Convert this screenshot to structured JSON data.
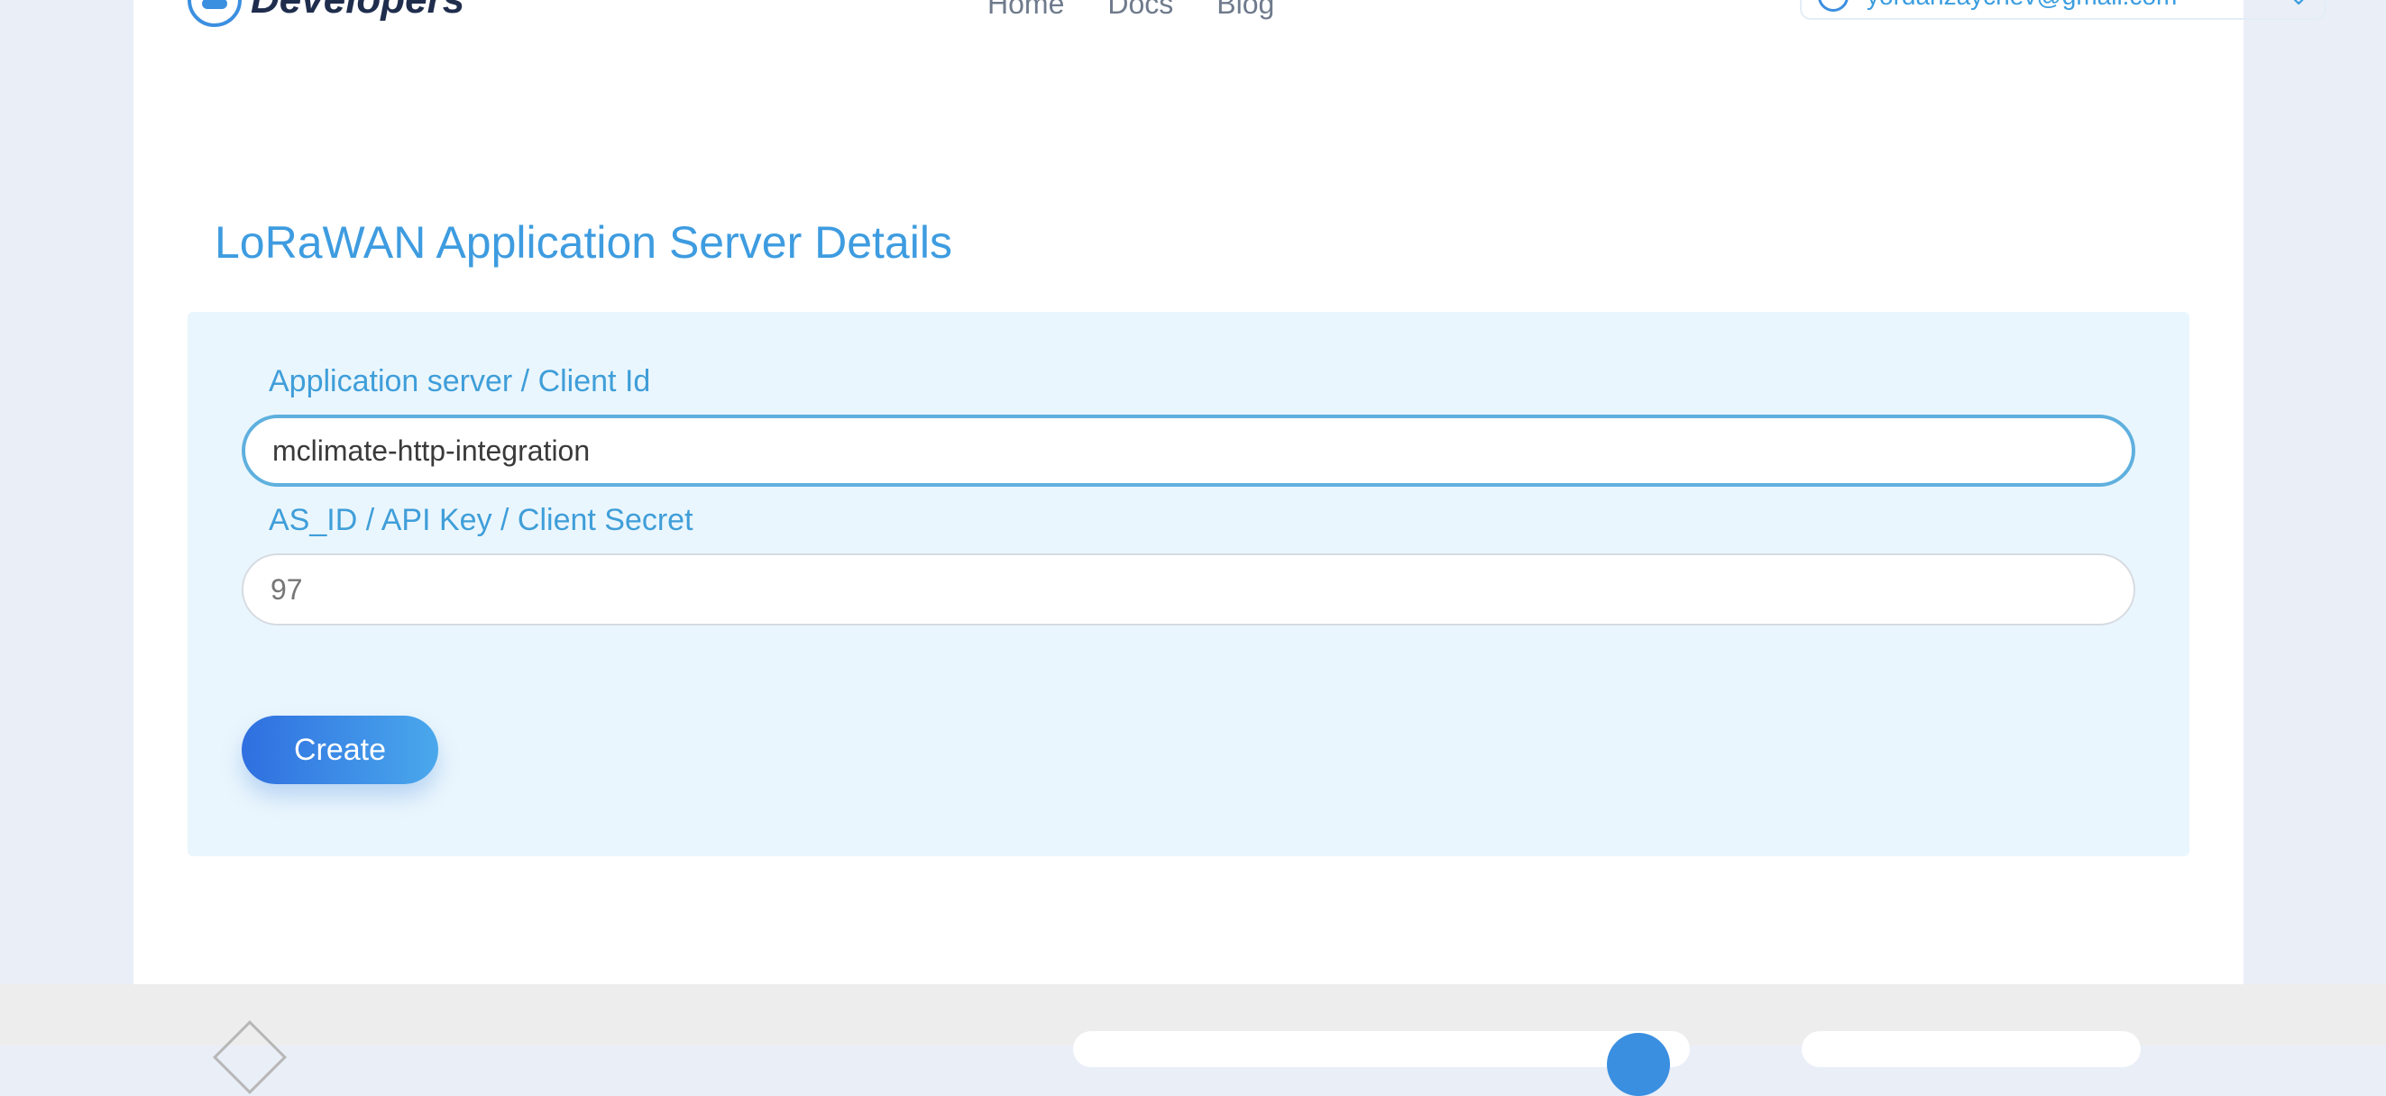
{
  "header": {
    "logo_text": "Developers",
    "nav": [
      "Home",
      "Docs",
      "Blog"
    ],
    "account_email": "yordanzaychev@gmail.com"
  },
  "main": {
    "title": "LoRaWAN Application Server Details",
    "form": {
      "client_id_label": "Application server / Client Id",
      "client_id_value": "mclimate-http-integration",
      "secret_label": "AS_ID / API Key / Client Secret",
      "secret_value": "97",
      "create_label": "Create"
    }
  },
  "colors": {
    "accent": "#3e9ce0",
    "card_bg": "#eaf6fd",
    "button_start": "#2f6fe0",
    "button_end": "#4aa8ec"
  }
}
